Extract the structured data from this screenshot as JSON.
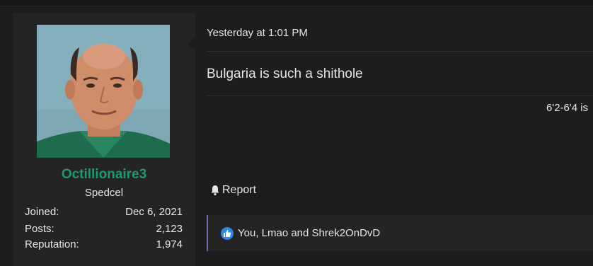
{
  "user": {
    "name": "Octillionaire3",
    "title": "Spedcel",
    "stats": [
      {
        "label": "Joined:",
        "value": "Dec 6, 2021"
      },
      {
        "label": "Posts:",
        "value": "2,123"
      },
      {
        "label": "Reputation:",
        "value": "1,974"
      }
    ],
    "avatar_icon": "avatar-portrait",
    "name_color": "#1d9a6c"
  },
  "post": {
    "date": "Yesterday at 1:01 PM",
    "text": "Bulgaria is such a shithole",
    "signature": "6'2-6'4 is"
  },
  "actions": {
    "report_label": "Report",
    "report_icon": "bell-icon"
  },
  "reactions": {
    "icon": "like-icon",
    "text": "You, Lmao and Shrek2OnDvD",
    "accent": "#6b63b5"
  }
}
